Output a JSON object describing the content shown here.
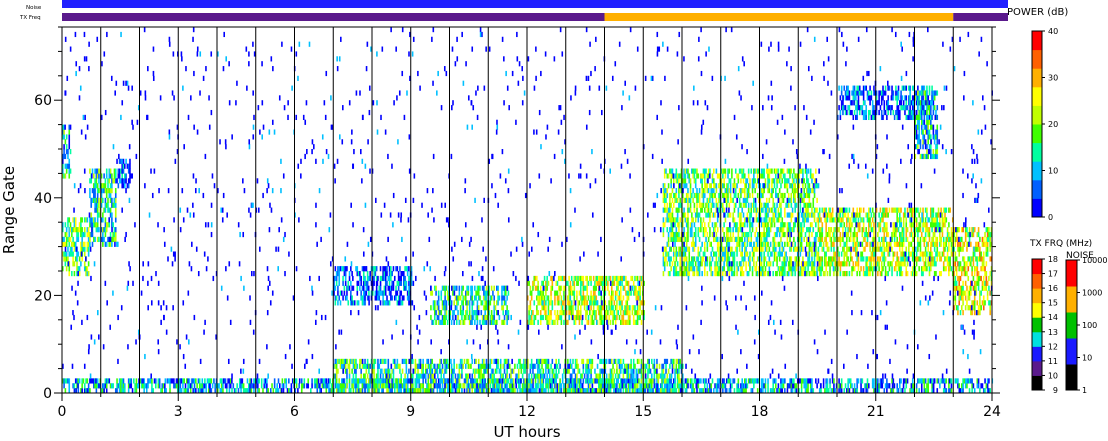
{
  "chart_data": {
    "type": "heatmap",
    "xlabel": "UT hours",
    "ylabel": "Range Gate",
    "xlim": [
      0,
      24
    ],
    "ylim": [
      0,
      75
    ],
    "x_ticks": [
      0,
      3,
      6,
      9,
      12,
      15,
      18,
      21,
      24
    ],
    "y_ticks": [
      0,
      20,
      40,
      60
    ],
    "grid": "vertical lines every hour",
    "strip_labels": {
      "noise": "Noise",
      "tx_freq": "TX Freq"
    },
    "tx_freq_strip": [
      {
        "from": 0,
        "to": 14,
        "color": "#5a1a8c"
      },
      {
        "from": 14,
        "to": 23,
        "color": "#ffb000"
      },
      {
        "from": 23,
        "to": 24,
        "color": "#5a1a8c"
      }
    ],
    "noise_strip_color": "#2020ff",
    "power_colorbar": {
      "title": "POWER (dB)",
      "ticks": [
        "0",
        "10",
        "20",
        "30",
        "40"
      ],
      "colors": [
        "#0000ff",
        "#0060ff",
        "#00c0ff",
        "#00ffa0",
        "#40ff00",
        "#c0ff00",
        "#ffff00",
        "#ffb000",
        "#ff6000",
        "#ff0000"
      ]
    },
    "tx_freq_colorbar": {
      "title": "TX FRQ (MHz)",
      "ticks": [
        "9",
        "10",
        "11",
        "12",
        "13",
        "14",
        "15",
        "16",
        "17",
        "18"
      ],
      "colors": [
        "#000000",
        "#5a1a8c",
        "#1a1aff",
        "#00e0e0",
        "#00c000",
        "#ffff00",
        "#ffb000",
        "#ff6000",
        "#ff0000"
      ]
    },
    "noise_colorbar": {
      "title": "NOISE",
      "ticks": [
        "1",
        "10",
        "100",
        "1000",
        "10000"
      ],
      "colors": [
        "#000000",
        "#1a1aff",
        "#00c000",
        "#ffb000",
        "#ff0000"
      ]
    },
    "echo_regions": [
      {
        "x0": 0.0,
        "x1": 0.7,
        "y0": 24,
        "y1": 36,
        "level": 0.45
      },
      {
        "x0": 0.0,
        "x1": 0.2,
        "y0": 44,
        "y1": 55,
        "level": 0.3
      },
      {
        "x0": 0.7,
        "x1": 1.4,
        "y0": 30,
        "y1": 46,
        "level": 0.35
      },
      {
        "x0": 1.4,
        "x1": 1.75,
        "y0": 42,
        "y1": 48,
        "level": 0.15
      },
      {
        "x0": 7.0,
        "x1": 9.0,
        "y0": 18,
        "y1": 26,
        "level": 0.15
      },
      {
        "x0": 9.5,
        "x1": 11.5,
        "y0": 14,
        "y1": 22,
        "level": 0.35
      },
      {
        "x0": 12.0,
        "x1": 15.0,
        "y0": 14,
        "y1": 24,
        "level": 0.55
      },
      {
        "x0": 15.5,
        "x1": 19.5,
        "y0": 24,
        "y1": 46,
        "level": 0.45
      },
      {
        "x0": 19.5,
        "x1": 23.0,
        "y0": 24,
        "y1": 38,
        "level": 0.55
      },
      {
        "x0": 20.0,
        "x1": 22.5,
        "y0": 56,
        "y1": 63,
        "level": 0.15
      },
      {
        "x0": 22.0,
        "x1": 22.6,
        "y0": 48,
        "y1": 62,
        "level": 0.3
      },
      {
        "x0": 23.0,
        "x1": 24.0,
        "y0": 16,
        "y1": 34,
        "level": 0.6
      },
      {
        "x0": 0.0,
        "x1": 24.0,
        "y0": 0,
        "y1": 3,
        "level": 0.25
      },
      {
        "x0": 7.0,
        "x1": 16.0,
        "y0": 0,
        "y1": 7,
        "level": 0.35
      }
    ]
  }
}
